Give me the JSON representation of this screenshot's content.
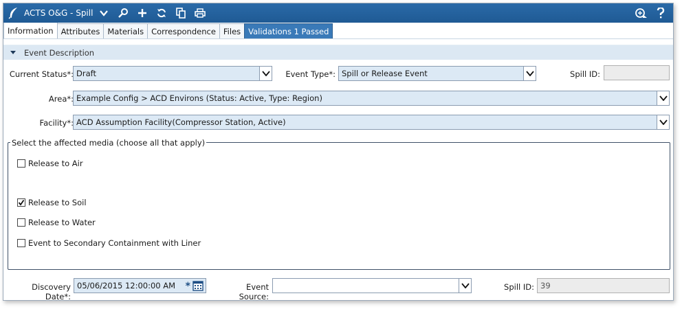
{
  "window": {
    "title": "ACTS O&G - Spill"
  },
  "tabs": [
    {
      "label": "Information",
      "active": true
    },
    {
      "label": "Attributes"
    },
    {
      "label": "Materials"
    },
    {
      "label": "Correspondence"
    },
    {
      "label": "Files"
    },
    {
      "label": "Validations 1 Passed"
    }
  ],
  "section": {
    "title": "Event Description"
  },
  "form": {
    "current_status": {
      "label": "Current Status*:",
      "value": "Draft"
    },
    "event_type": {
      "label": "Event Type*:",
      "value": "Spill or Release Event"
    },
    "spill_id_top": {
      "label": "Spill ID:",
      "value": ""
    },
    "area": {
      "label": "Area*:",
      "value": "Example Config > ACD Environs (Status: Active, Type: Region)"
    },
    "facility": {
      "label": "Facility*:",
      "value": "ACD Assumption Facility(Compressor Station, Active)"
    },
    "media": {
      "legend": "Select the affected media (choose all that apply)",
      "options": [
        {
          "label": "Release to Air",
          "checked": false
        },
        {
          "label": "Release to Soil",
          "checked": true
        },
        {
          "label": "Release to Water",
          "checked": false
        },
        {
          "label": "Event to Secondary Containment with Liner",
          "checked": false
        }
      ]
    },
    "discovery_date": {
      "label": "Discovery Date*:",
      "value": "05/06/2015 12:00:00 AM",
      "required_mark": "*"
    },
    "event_source": {
      "label": "Event Source:",
      "value": ""
    },
    "spill_id_bottom": {
      "label": "Spill ID:",
      "value": "39"
    }
  },
  "colors": {
    "titlebar": "#1f5a94",
    "select_bg": "#dce9f5",
    "section_bg": "#dce8f3",
    "validations_tab": "#3a7ab8"
  }
}
